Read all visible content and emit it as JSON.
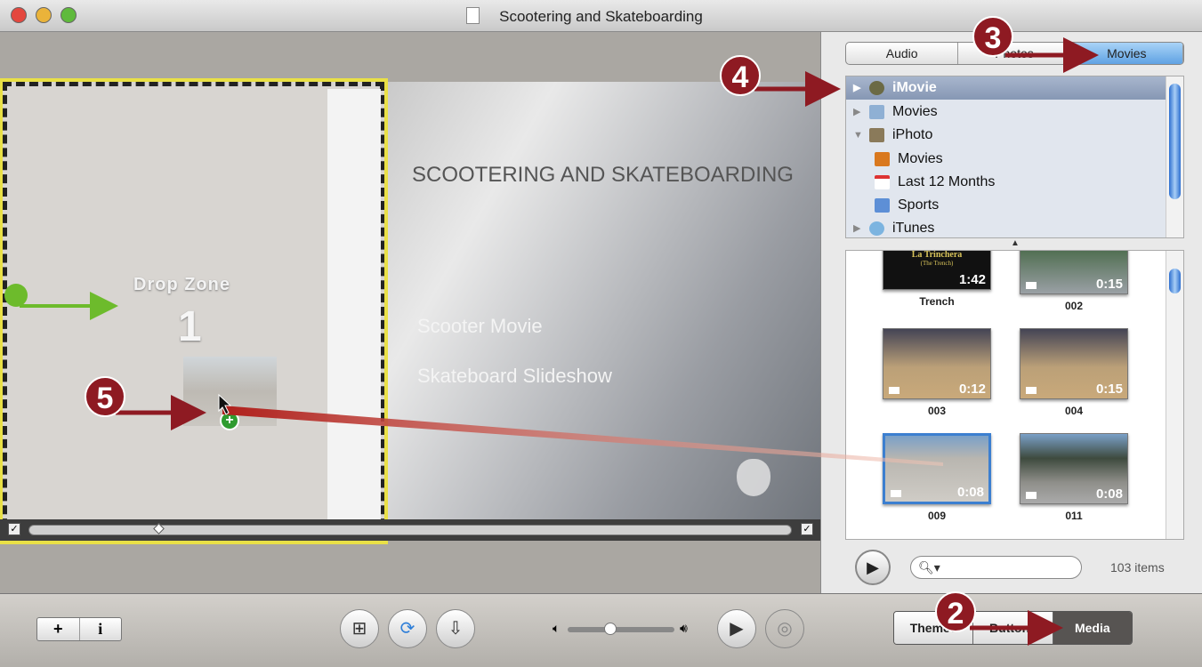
{
  "window": {
    "title": "Scootering and Skateboarding"
  },
  "stage": {
    "title": "SCOOTERING AND SKATEBOARDING",
    "menu": [
      "Scooter Movie",
      "Skateboard Slideshow"
    ],
    "drop_zone_label": "Drop Zone",
    "drop_zone_number": "1"
  },
  "browser": {
    "tabs": [
      {
        "label": "Audio"
      },
      {
        "label": "Photos"
      },
      {
        "label": "Movies",
        "active": true
      }
    ],
    "tree": [
      {
        "label": "iMovie",
        "icon": "imovie-star-icon",
        "selected": true,
        "expand": "collapsed"
      },
      {
        "label": "Movies",
        "icon": "folder-movies-icon",
        "expand": "collapsed"
      },
      {
        "label": "iPhoto",
        "icon": "iphoto-icon",
        "expand": "expanded"
      },
      {
        "label": "Movies",
        "icon": "iphoto-movies-icon",
        "indent": true
      },
      {
        "label": "Last 12 Months",
        "icon": "calendar-icon",
        "indent": true
      },
      {
        "label": "Sports",
        "icon": "album-icon",
        "indent": true
      },
      {
        "label": "iTunes",
        "icon": "itunes-icon",
        "expand": "collapsed"
      }
    ],
    "clips": [
      {
        "name": "Trench",
        "duration": "1:42",
        "poster_title": "La Trinchera",
        "poster_subtitle": "(The Trench)"
      },
      {
        "name": "002",
        "duration": "0:15"
      },
      {
        "name": "003",
        "duration": "0:12"
      },
      {
        "name": "004",
        "duration": "0:15"
      },
      {
        "name": "009",
        "duration": "0:08",
        "selected": true
      },
      {
        "name": "011",
        "duration": "0:08"
      }
    ],
    "search_placeholder": "",
    "item_count": "103 items"
  },
  "toolbar": {
    "add_label": "+",
    "info_label": "i",
    "segments": [
      {
        "label": "Themes"
      },
      {
        "label": "Buttons"
      },
      {
        "label": "Media",
        "active": true
      }
    ],
    "volume": 0.4
  },
  "callouts": [
    "2",
    "3",
    "4",
    "5"
  ],
  "colors": {
    "callout": "#8e1a22",
    "selection": "#3c7fd0",
    "drop_zone_stripe": "#e9e046"
  }
}
